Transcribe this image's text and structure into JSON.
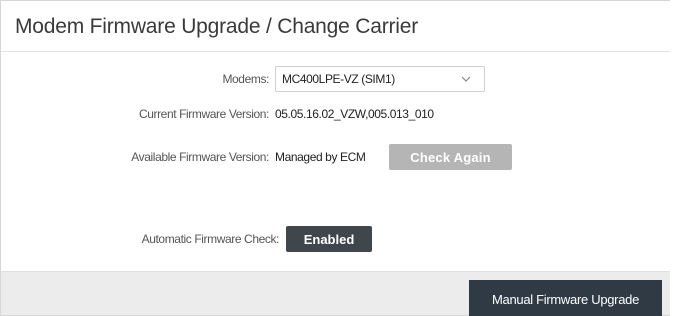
{
  "dialog": {
    "title": "Modem Firmware Upgrade / Change Carrier"
  },
  "fields": {
    "modems": {
      "label": "Modems:",
      "selected": "MC400LPE-VZ (SIM1)",
      "icon": "chevron-down-icon"
    },
    "current_version": {
      "label": "Current Firmware Version:",
      "value": "05.05.16.02_VZW,005.013_010"
    },
    "available_version": {
      "label": "Available Firmware Version:",
      "value": "Managed by ECM",
      "button_label": "Check Again"
    },
    "automatic_check": {
      "label": "Automatic Firmware Check:",
      "button_label": "Enabled"
    }
  },
  "footer": {
    "upgrade_button_label": "Manual Firmware Upgrade"
  },
  "colors": {
    "disabled_button": "#b5b5b5",
    "dark_button": "#3f464c",
    "primary_button": "#2f3a44",
    "footer_bg": "#ececec"
  }
}
